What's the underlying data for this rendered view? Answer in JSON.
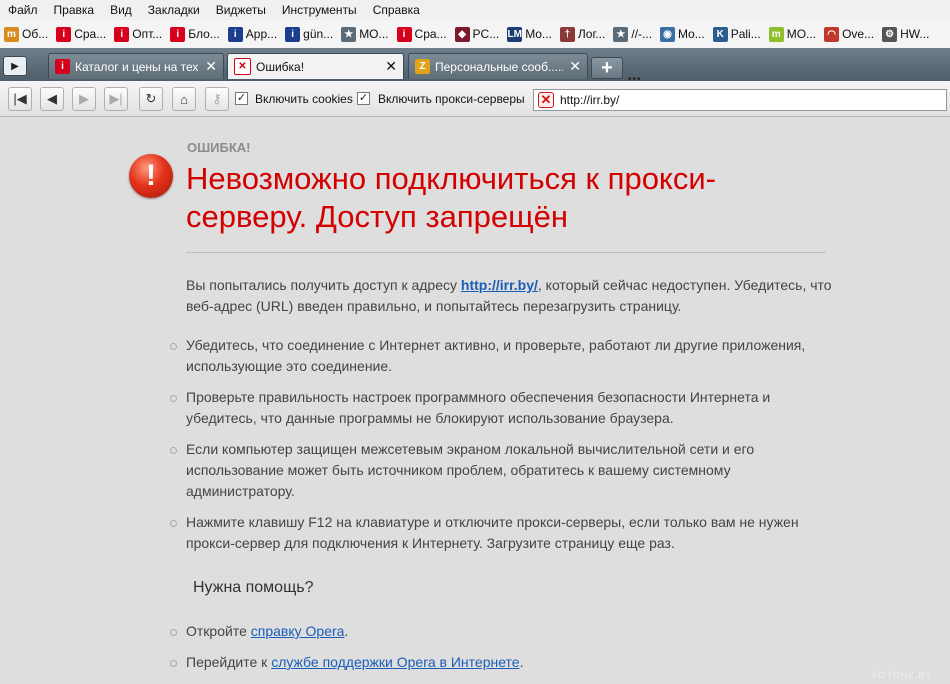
{
  "menu": [
    "Файл",
    "Правка",
    "Вид",
    "Закладки",
    "Виджеты",
    "Инструменты",
    "Справка"
  ],
  "bookmarks": [
    {
      "label": "Об...",
      "icon": "m",
      "color": "#d98c1e"
    },
    {
      "label": "Сра...",
      "icon": "i",
      "color": "#d6001c"
    },
    {
      "label": "Опт...",
      "icon": "i",
      "color": "#d6001c"
    },
    {
      "label": "Бло...",
      "icon": "i",
      "color": "#d6001c"
    },
    {
      "label": "App...",
      "icon": "i",
      "color": "#1c3f8c"
    },
    {
      "label": "gün...",
      "icon": "i",
      "color": "#1c3f8c"
    },
    {
      "label": "MO...",
      "icon": "★",
      "color": "#5b6a79"
    },
    {
      "label": "Сра...",
      "icon": "i",
      "color": "#d6001c"
    },
    {
      "label": "PC...",
      "icon": "◆",
      "color": "#7b1a2a"
    },
    {
      "label": "Mo...",
      "icon": "LM",
      "color": "#1d3c73"
    },
    {
      "label": "Лог...",
      "icon": "†",
      "color": "#8b3a3a"
    },
    {
      "label": "//-...",
      "icon": "★",
      "color": "#5b6a79"
    },
    {
      "label": "Mo...",
      "icon": "◉",
      "color": "#3a6ea5"
    },
    {
      "label": "Pali...",
      "icon": "K",
      "color": "#2c5d8f"
    },
    {
      "label": "MO...",
      "icon": "m",
      "color": "#8fbf2a"
    },
    {
      "label": "Ove...",
      "icon": "◠",
      "color": "#c0392b"
    },
    {
      "label": "HW...",
      "icon": "⚙",
      "color": "#555555"
    }
  ],
  "tabs": [
    {
      "title": "Каталог и цены на тех...",
      "icon": "i",
      "color": "#d6001c",
      "active": false
    },
    {
      "title": "Ошибка!",
      "icon": "✕",
      "color": "#d6001c",
      "active": true
    },
    {
      "title": "Персональные сооб.....",
      "icon": "Z",
      "color": "#e0a21b",
      "active": false
    }
  ],
  "toolbar": {
    "cookies_label": "Включить cookies",
    "cookies_checked": "✓",
    "proxy_label": "Включить прокси-серверы",
    "proxy_checked": "✓",
    "url": "http://irr.by/"
  },
  "error": {
    "label": "ОШИБКА!",
    "title": "Невозможно подключиться к прокси-серверу. Доступ запрещён",
    "intro_before": "Вы попытались получить доступ к адресу ",
    "intro_link": "http://irr.by/",
    "intro_after": ", который сейчас недоступен. Убедитесь, что веб-адрес (URL) введен правильно, и попытайтесь перезагрузить страницу.",
    "tips": [
      "Убедитесь, что соединение с Интернет активно, и проверьте, работают ли другие приложения, использующие это соединение.",
      "Проверьте правильность настроек программного обеспечения безопасности Интернета и убедитесь, что данные программы не блокируют использование браузера.",
      "Если компьютер защищен межсетевым экраном локальной вычислительной сети и его использование может быть источником проблем, обратитесь к вашему системному администратору.",
      "Нажмите клавишу F12 на клавиатуре и отключите прокси-серверы, если только вам не нужен прокси-сервер для подключения к Интернету. Загрузите страницу еще раз."
    ],
    "help_heading": "Нужна помощь?",
    "help1_before": "Откройте ",
    "help1_link": "справку Opera",
    "help1_after": ".",
    "help2_before": "Перейдите к ",
    "help2_link": "службе поддержки Opera в Интернете",
    "help2_after": "."
  },
  "watermark": "FOTOHZ.BY"
}
